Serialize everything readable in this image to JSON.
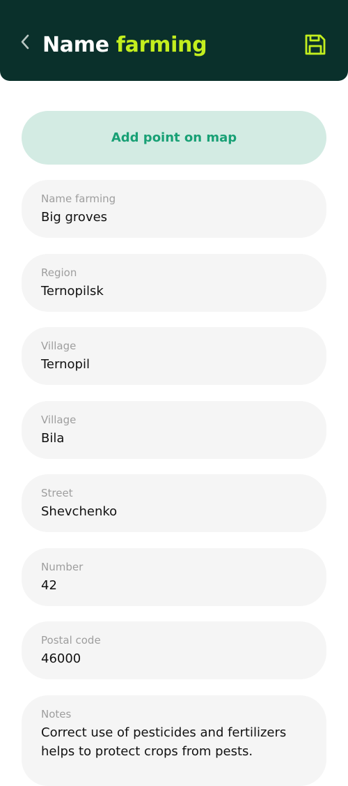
{
  "header": {
    "title_main": "Name",
    "title_accent": "farming",
    "back_icon": "chevron-left-icon",
    "save_icon": "floppy-disk-icon",
    "colors": {
      "background": "#0a302b",
      "accent": "#c3ee1e",
      "text": "#ffffff"
    }
  },
  "map_button": {
    "label": "Add point on map",
    "colors": {
      "background": "#d3ebe3",
      "text": "#18a075"
    }
  },
  "fields": [
    {
      "label": "Name farming",
      "value": "Big groves"
    },
    {
      "label": "Region",
      "value": "Ternopilsk"
    },
    {
      "label": "Village",
      "value": "Ternopil"
    },
    {
      "label": "Village",
      "value": "Bila"
    },
    {
      "label": "Street",
      "value": "Shevchenko"
    },
    {
      "label": "Number",
      "value": "42"
    },
    {
      "label": "Postal code",
      "value": "46000"
    }
  ],
  "notes": {
    "label": "Notes",
    "value": "Correct use of pesticides and fertilizers helps to protect crops from pests."
  }
}
